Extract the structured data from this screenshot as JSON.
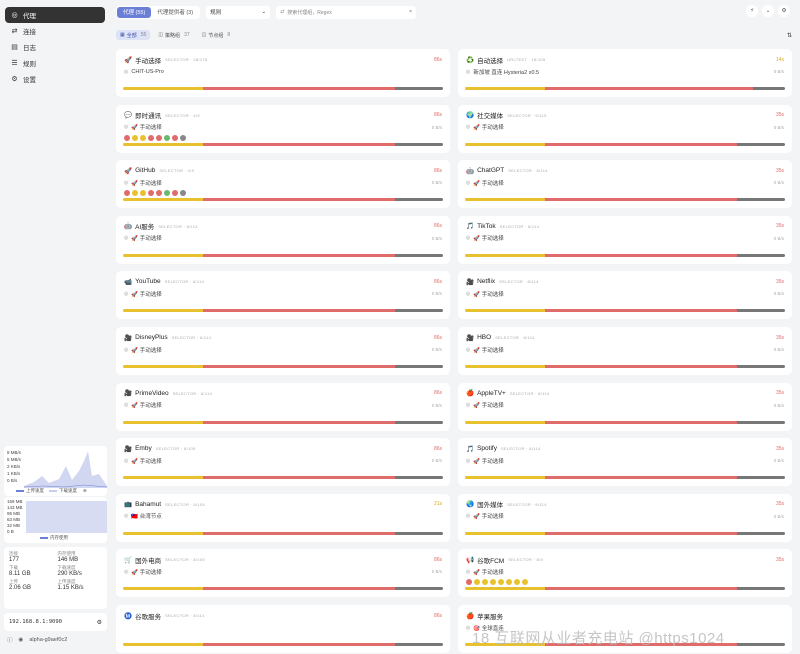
{
  "sidebar": {
    "items": [
      {
        "label": "代理",
        "icon": "globe-icon",
        "active": true
      },
      {
        "label": "连接",
        "icon": "arrows-icon",
        "active": false
      },
      {
        "label": "日志",
        "icon": "document-icon",
        "active": false
      },
      {
        "label": "规则",
        "icon": "rules-icon",
        "active": false
      },
      {
        "label": "设置",
        "icon": "gear-icon",
        "active": false
      }
    ],
    "traffic_chart": {
      "y_ticks": [
        "8 MB/s",
        "5 MB/s",
        "2 KB/s",
        "1 KB/s",
        "0 B/s"
      ],
      "legend_up": "上传速度",
      "legend_down": "下载速度"
    },
    "memory_chart": {
      "y_ticks": [
        "159 MB",
        "143 MB",
        "95 MB",
        "63 MB",
        "32 MB",
        "0 B"
      ],
      "legend": "内存使用"
    },
    "stats": [
      {
        "k": "连接",
        "v": "177"
      },
      {
        "k": "内存使用",
        "v": "146 MB"
      },
      {
        "k": "下载",
        "v": "8.11 GB"
      },
      {
        "k": "下载速度",
        "v": "290 KB/s"
      },
      {
        "k": "上传",
        "v": "2.06 GB"
      },
      {
        "k": "上传速度",
        "v": "1.15 KB/s"
      }
    ],
    "controller": "192.168.8.1:9090",
    "bottom": {
      "version": "clash-meta",
      "label": "alpha-g9aef0c2"
    }
  },
  "topbar": {
    "tabs": [
      {
        "label": "代理 (55)",
        "active": true
      },
      {
        "label": "代理提供者 (3)",
        "active": false
      }
    ],
    "mode_select": "规则",
    "search_placeholder": "搜索代理组，Regex"
  },
  "filters": [
    {
      "label": "全部",
      "count": "55",
      "active": true
    },
    {
      "label": "策略组",
      "count": "37",
      "active": false
    },
    {
      "label": "节点组",
      "count": "8",
      "active": false
    }
  ],
  "groups": [
    {
      "emoji": "🚀",
      "name": "手动选择",
      "type": "SELECTOR · 28/178",
      "latency": "86s",
      "sub": "CHIT-US-Pro",
      "sub_icon": "◎",
      "speed": "",
      "dots": [],
      "bar": [
        0,
        25,
        60,
        15
      ]
    },
    {
      "emoji": "♻️",
      "name": "自动选择",
      "type": "URLTEST · 18/105",
      "latency": "14s",
      "lat_yellow": true,
      "sub": "新加坡 直连 Hysteria2 x0.5",
      "sub_icon": "◎",
      "speed": "0 B/s",
      "dots": [],
      "bar": [
        0,
        25,
        65,
        10
      ]
    },
    {
      "emoji": "💬",
      "name": "即时通讯",
      "type": "SELECTOR · 4/9",
      "latency": "86s",
      "sub": "🚀 手动选择",
      "sub_icon": "◎",
      "speed": "0 B/s",
      "dots": [
        "#e06b6b",
        "#e8c12e",
        "#e8c12e",
        "#e06b6b",
        "#e06b6b",
        "#6db66d",
        "#e06b6b",
        "#888"
      ],
      "bar": [
        0,
        25,
        60,
        15
      ]
    },
    {
      "emoji": "🌍",
      "name": "社交媒体",
      "type": "SELECTOR · 5/115",
      "latency": "35s",
      "sub": "🚀 手动选择",
      "sub_icon": "◎",
      "speed": "0 B/s",
      "dots": [],
      "bar": [
        0,
        25,
        60,
        15
      ]
    },
    {
      "emoji": "🚀",
      "name": "GitHub",
      "type": "SELECTOR · 4/9",
      "latency": "86s",
      "sub": "🚀 手动选择",
      "sub_icon": "◎",
      "speed": "0 B/s",
      "dots": [
        "#e06b6b",
        "#e8c12e",
        "#e8c12e",
        "#e06b6b",
        "#e06b6b",
        "#6db66d",
        "#e06b6b",
        "#888"
      ],
      "bar": [
        0,
        25,
        60,
        15
      ]
    },
    {
      "emoji": "🤖",
      "name": "ChatGPT",
      "type": "SELECTOR · 8/114",
      "latency": "35s",
      "sub": "🚀 手动选择",
      "sub_icon": "◎",
      "speed": "0 B/s",
      "dots": [],
      "bar": [
        0,
        25,
        60,
        15
      ]
    },
    {
      "emoji": "🤖",
      "name": "AI服务",
      "type": "SELECTOR · 8/114",
      "latency": "86s",
      "sub": "🚀 手动选择",
      "sub_icon": "◎",
      "speed": "0 B/s",
      "dots": [],
      "bar": [
        0,
        25,
        60,
        15
      ]
    },
    {
      "emoji": "🎵",
      "name": "TikTok",
      "type": "SELECTOR · 8/114",
      "latency": "35s",
      "sub": "🚀 手动选择",
      "sub_icon": "◎",
      "speed": "0 B/s",
      "dots": [],
      "bar": [
        0,
        25,
        60,
        15
      ]
    },
    {
      "emoji": "📹",
      "name": "YouTube",
      "type": "SELECTOR · 8/114",
      "latency": "86s",
      "sub": "🚀 手动选择",
      "sub_icon": "◎",
      "speed": "0 B/s",
      "dots": [],
      "bar": [
        0,
        25,
        60,
        15
      ]
    },
    {
      "emoji": "🎥",
      "name": "Netflix",
      "type": "SELECTOR · 8/114",
      "latency": "35s",
      "sub": "🚀 手动选择",
      "sub_icon": "◎",
      "speed": "0 B/s",
      "dots": [],
      "bar": [
        0,
        25,
        60,
        15
      ]
    },
    {
      "emoji": "🎥",
      "name": "DisneyPlus",
      "type": "SELECTOR · 8/114",
      "latency": "86s",
      "sub": "🚀 手动选择",
      "sub_icon": "◎",
      "speed": "0 B/s",
      "dots": [],
      "bar": [
        0,
        25,
        60,
        15
      ]
    },
    {
      "emoji": "🎥",
      "name": "HBO",
      "type": "SELECTOR · 8/114",
      "latency": "35s",
      "sub": "🚀 手动选择",
      "sub_icon": "◎",
      "speed": "0 B/s",
      "dots": [],
      "bar": [
        0,
        25,
        60,
        15
      ]
    },
    {
      "emoji": "🎥",
      "name": "PrimeVideo",
      "type": "SELECTOR · 8/114",
      "latency": "86s",
      "sub": "🚀 手动选择",
      "sub_icon": "◎",
      "speed": "0 B/s",
      "dots": [],
      "bar": [
        0,
        25,
        60,
        15
      ]
    },
    {
      "emoji": "🍎",
      "name": "AppleTV+",
      "type": "SELECTOR · 8/114",
      "latency": "35s",
      "sub": "🚀 手动选择",
      "sub_icon": "◎",
      "speed": "0 B/s",
      "dots": [],
      "bar": [
        0,
        25,
        60,
        15
      ]
    },
    {
      "emoji": "🎥",
      "name": "Emby",
      "type": "SELECTOR · 8/105",
      "latency": "86s",
      "sub": "🚀 手动选择",
      "sub_icon": "◎",
      "speed": "0 B/s",
      "dots": [],
      "bar": [
        0,
        25,
        60,
        15
      ]
    },
    {
      "emoji": "🎵",
      "name": "Spotify",
      "type": "SELECTOR · 8/114",
      "latency": "35s",
      "sub": "🚀 手动选择",
      "sub_icon": "◎",
      "speed": "0 B/s",
      "dots": [],
      "bar": [
        0,
        25,
        60,
        15
      ]
    },
    {
      "emoji": "📺",
      "name": "Bahamut",
      "type": "SELECTOR · 8/105",
      "latency": "21s",
      "lat_yellow": true,
      "sub": "🇹🇼 台湾节点",
      "sub_icon": "◎",
      "speed": "",
      "dots": [],
      "bar": [
        0,
        25,
        60,
        15
      ]
    },
    {
      "emoji": "🌏",
      "name": "国外媒体",
      "type": "SELECTOR · 8/114",
      "latency": "35s",
      "sub": "🚀 手动选择",
      "sub_icon": "◎",
      "speed": "0 B/s",
      "dots": [],
      "bar": [
        0,
        25,
        60,
        15
      ]
    },
    {
      "emoji": "🛒",
      "name": "国外电商",
      "type": "SELECTOR · 8/105",
      "latency": "86s",
      "sub": "🚀 手动选择",
      "sub_icon": "◎",
      "speed": "0 B/s",
      "dots": [],
      "bar": [
        0,
        25,
        60,
        15
      ]
    },
    {
      "emoji": "📢",
      "name": "谷歌FCM",
      "type": "SELECTOR · 8/9",
      "latency": "35s",
      "sub": "🚀 手动选择",
      "sub_icon": "◎",
      "speed": "",
      "dots": [
        "#e06b6b",
        "#e8c12e",
        "#e8c12e",
        "#e8c12e",
        "#e8c12e",
        "#e8c12e",
        "#e8c12e",
        "#e8c12e"
      ],
      "bar": [
        0,
        25,
        60,
        15
      ]
    },
    {
      "emoji": "Ⓜ️",
      "name": "谷歌服务",
      "type": "SELECTOR · 8/114",
      "latency": "86s",
      "sub": "",
      "sub_icon": "",
      "speed": "",
      "dots": [],
      "bar": [
        0,
        25,
        60,
        15
      ]
    },
    {
      "emoji": "🍎",
      "name": "苹果服务",
      "type": "",
      "latency": "",
      "sub": "🎯 全球直连",
      "sub_icon": "◎",
      "speed": "",
      "dots": [],
      "bar": [
        0,
        25,
        60,
        15
      ]
    }
  ],
  "watermark": "18 互联网从业者充电站 @https1024",
  "colors": {
    "accent": "#6b7fd7",
    "red": "#e06b6b",
    "yellow": "#e8c12e",
    "green": "#6db66d"
  }
}
